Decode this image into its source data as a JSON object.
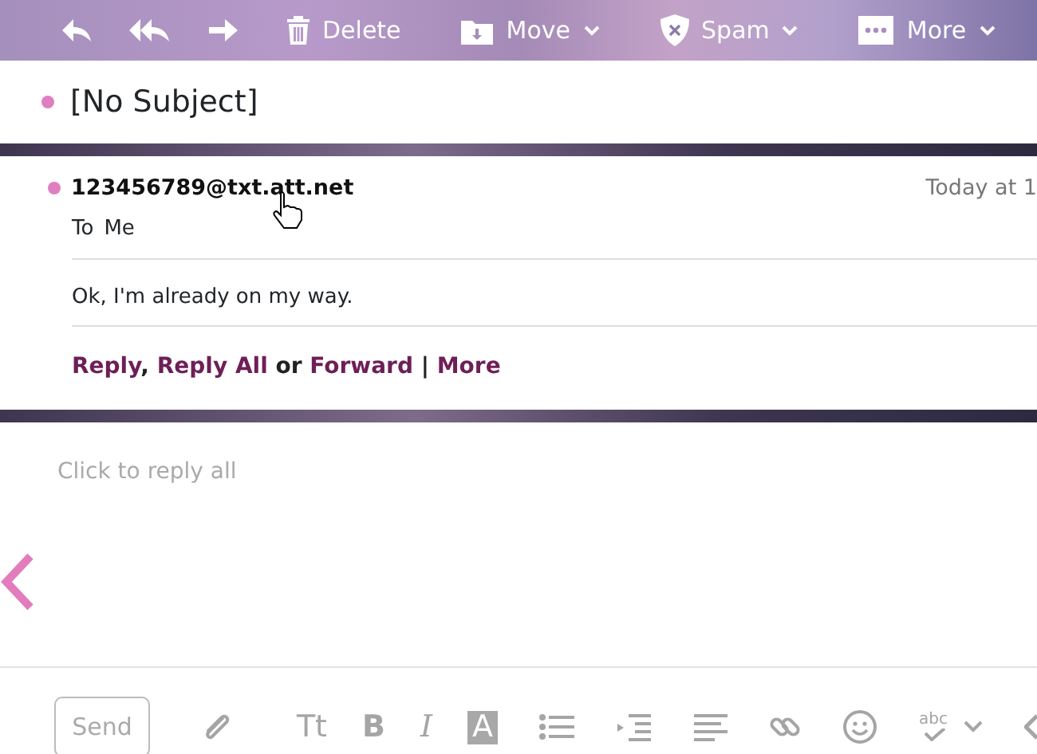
{
  "toolbar": {
    "items": [
      {
        "kind": "reply"
      },
      {
        "kind": "reply-all"
      },
      {
        "kind": "forward"
      },
      {
        "kind": "delete",
        "label": "Delete"
      },
      {
        "kind": "move",
        "label": "Move",
        "dropdown": true
      },
      {
        "kind": "spam",
        "label": "Spam",
        "dropdown": true
      },
      {
        "kind": "more",
        "label": "More",
        "dropdown": true
      }
    ]
  },
  "subject": {
    "text": "[No Subject]",
    "unread": true
  },
  "message": {
    "sender": "123456789@txt.att.net",
    "unread": true,
    "time": "Today at 1",
    "to_label": "To",
    "to": "Me",
    "body": "Ok, I'm already on my way.",
    "actions": [
      {
        "kind": "link",
        "text": "Reply"
      },
      {
        "kind": "text",
        "text": ", "
      },
      {
        "kind": "link",
        "text": "Reply All"
      },
      {
        "kind": "text",
        "text": " or "
      },
      {
        "kind": "link",
        "text": "Forward"
      },
      {
        "kind": "text",
        "text": " | "
      },
      {
        "kind": "link",
        "text": "More"
      }
    ]
  },
  "reply": {
    "placeholder": "Click to reply all"
  },
  "composer": {
    "send": "Send",
    "send_disabled": true,
    "tools": [
      {
        "kind": "attach"
      },
      {
        "kind": "text-size",
        "text": "Tt"
      },
      {
        "kind": "bold",
        "text": "B"
      },
      {
        "kind": "italic",
        "text": "I"
      },
      {
        "kind": "highlight",
        "text": "A"
      },
      {
        "kind": "bullets"
      },
      {
        "kind": "indent"
      },
      {
        "kind": "align"
      },
      {
        "kind": "link"
      },
      {
        "kind": "emoji"
      },
      {
        "kind": "spell",
        "text": "abc"
      },
      {
        "kind": "caret"
      },
      {
        "kind": "chevron"
      }
    ]
  }
}
